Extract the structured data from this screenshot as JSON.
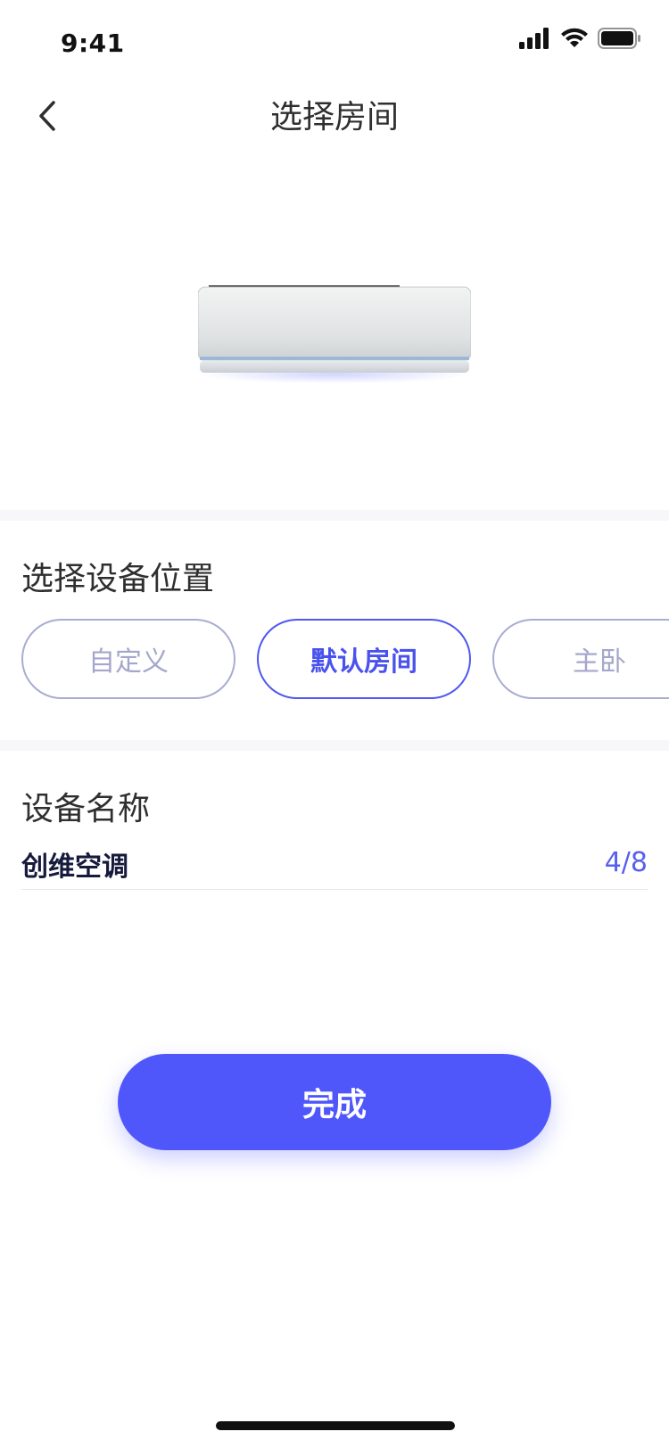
{
  "status_bar": {
    "time": "9:41",
    "icons": [
      "signal-icon",
      "wifi-icon",
      "battery-icon"
    ]
  },
  "nav": {
    "title": "选择房间",
    "back_icon": "chevron-left-icon"
  },
  "device": {
    "image": "air-conditioner-image"
  },
  "location": {
    "section_title": "选择设备位置",
    "options": [
      {
        "label": "自定义",
        "selected": false
      },
      {
        "label": "默认房间",
        "selected": true
      },
      {
        "label": "主卧",
        "selected": false
      }
    ]
  },
  "device_name": {
    "section_title": "设备名称",
    "value": "创维空调",
    "counter": "4/8"
  },
  "actions": {
    "done_label": "完成"
  },
  "colors": {
    "accent": "#4f57fb",
    "chip_inactive": "#a9acd2",
    "background": "#ffffff",
    "divider": "#f7f7f9"
  }
}
